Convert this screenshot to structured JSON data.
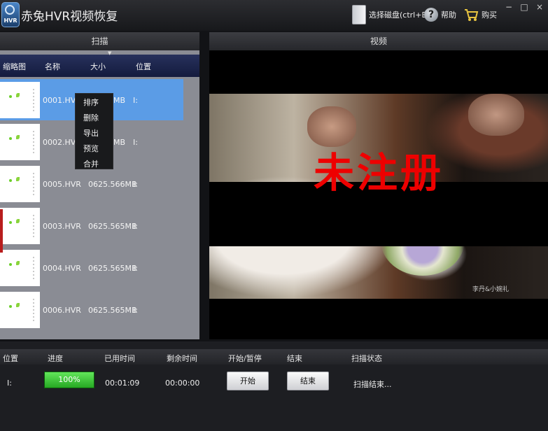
{
  "app": {
    "title": "赤兔HVR视频恢复",
    "logo_text": "HVR"
  },
  "toolbar": {
    "select_disk": "选择磁盘(ctrl+E)",
    "help": "帮助",
    "buy": "购买"
  },
  "window_controls": {
    "minimize": "−",
    "maximize": "□",
    "close": "×"
  },
  "panels": {
    "scan": "扫描",
    "video": "视频"
  },
  "columns": {
    "thumb": "缩略图",
    "name": "名称",
    "size": "大小",
    "location": "位置"
  },
  "files": [
    {
      "name": "0001.HVR",
      "size": "MB",
      "location": "I:",
      "selected": true
    },
    {
      "name": "0002.HVR",
      "size": "MB",
      "location": "I:"
    },
    {
      "name": "0005.HVR",
      "size": "0625.566MB",
      "location": "I:"
    },
    {
      "name": "0003.HVR",
      "size": "0625.565MB",
      "location": "I:"
    },
    {
      "name": "0004.HVR",
      "size": "0625.565MB",
      "location": "I:"
    },
    {
      "name": "0006.HVR",
      "size": "0625.565MB",
      "location": "I:"
    }
  ],
  "context_menu": [
    "排序",
    "删除",
    "导出",
    "预览",
    "合并"
  ],
  "video": {
    "watermark": "未注册",
    "caption": "李丹&小婉礼"
  },
  "status": {
    "headers": {
      "location": "位置",
      "progress": "进度",
      "elapsed": "已用时间",
      "remaining": "剩余时间",
      "start_pause": "开始/暂停",
      "end": "结束",
      "scan_status": "扫描状态"
    },
    "location": "I:",
    "progress": "100%",
    "progress_value": 1.0,
    "elapsed": "00:01:09",
    "remaining": "00:00:00",
    "start_button": "开始",
    "end_button": "结束",
    "scan_status": "扫描结束..."
  },
  "colors": {
    "selection": "#5b9ce6",
    "watermark": "#ee0000",
    "progress": "#2fb52a"
  }
}
